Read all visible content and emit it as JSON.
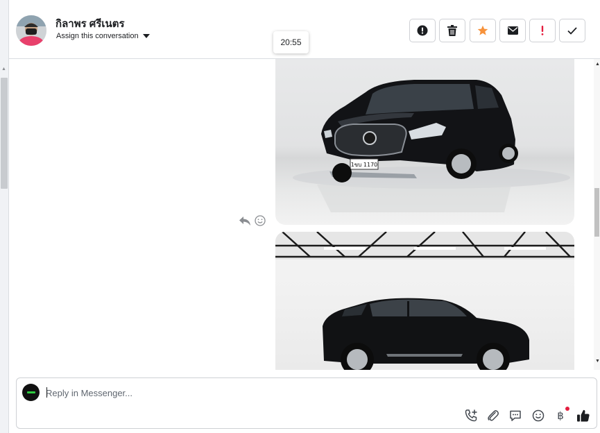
{
  "header": {
    "contact_name": "กิลาพร ศรีเนตร",
    "assign_label": "Assign this conversation",
    "tooltip_time": "20:55"
  },
  "actions": [
    {
      "name": "mark-spam-button",
      "icon": "exclamation-circle-icon"
    },
    {
      "name": "delete-button",
      "icon": "trash-icon"
    },
    {
      "name": "star-button",
      "icon": "star-icon",
      "color": "#f7923b"
    },
    {
      "name": "mark-unread-button",
      "icon": "envelope-icon"
    },
    {
      "name": "follow-up-button",
      "icon": "exclamation-icon",
      "color": "#e41e3f"
    },
    {
      "name": "mark-done-button",
      "icon": "check-icon"
    }
  ],
  "messages": [
    {
      "type": "image",
      "alt": "black SUV front three-quarter view in showroom",
      "plate": "1ขบ 1170"
    },
    {
      "type": "image",
      "alt": "black SUV side view in warehouse"
    }
  ],
  "composer": {
    "placeholder": "Reply in Messenger...",
    "tools": [
      "phone-add-icon",
      "paperclip-icon",
      "chat-bubble-icon",
      "emoji-icon",
      "baht-icon",
      "thumbs-up-icon"
    ],
    "baht_symbol": "฿"
  },
  "colors": {
    "accent_star": "#f7923b",
    "accent_alert": "#e41e3f",
    "border": "#ced0d4"
  }
}
